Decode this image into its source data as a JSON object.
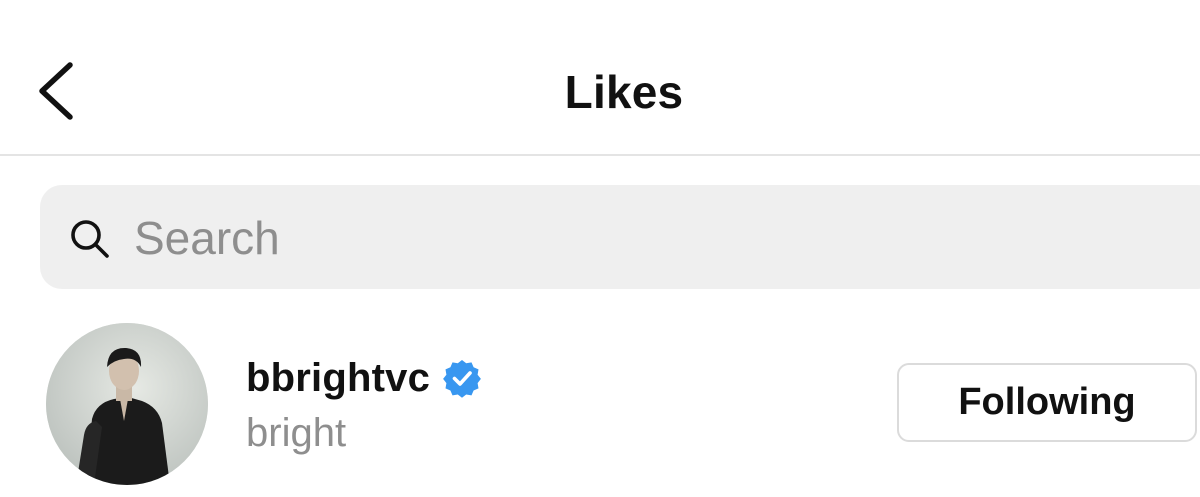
{
  "header": {
    "title": "Likes",
    "back_icon": "chevron-left-icon"
  },
  "search": {
    "placeholder": "Search",
    "icon": "search-icon"
  },
  "likes_list": [
    {
      "username": "bbrightvc",
      "verified": true,
      "full_name": "bright",
      "follow_button_label": "Following"
    }
  ],
  "colors": {
    "secondary_text": "#8e8e8e",
    "verified_badge": "#3897f0",
    "search_background": "#efefef",
    "button_border": "#dbdbdb"
  }
}
